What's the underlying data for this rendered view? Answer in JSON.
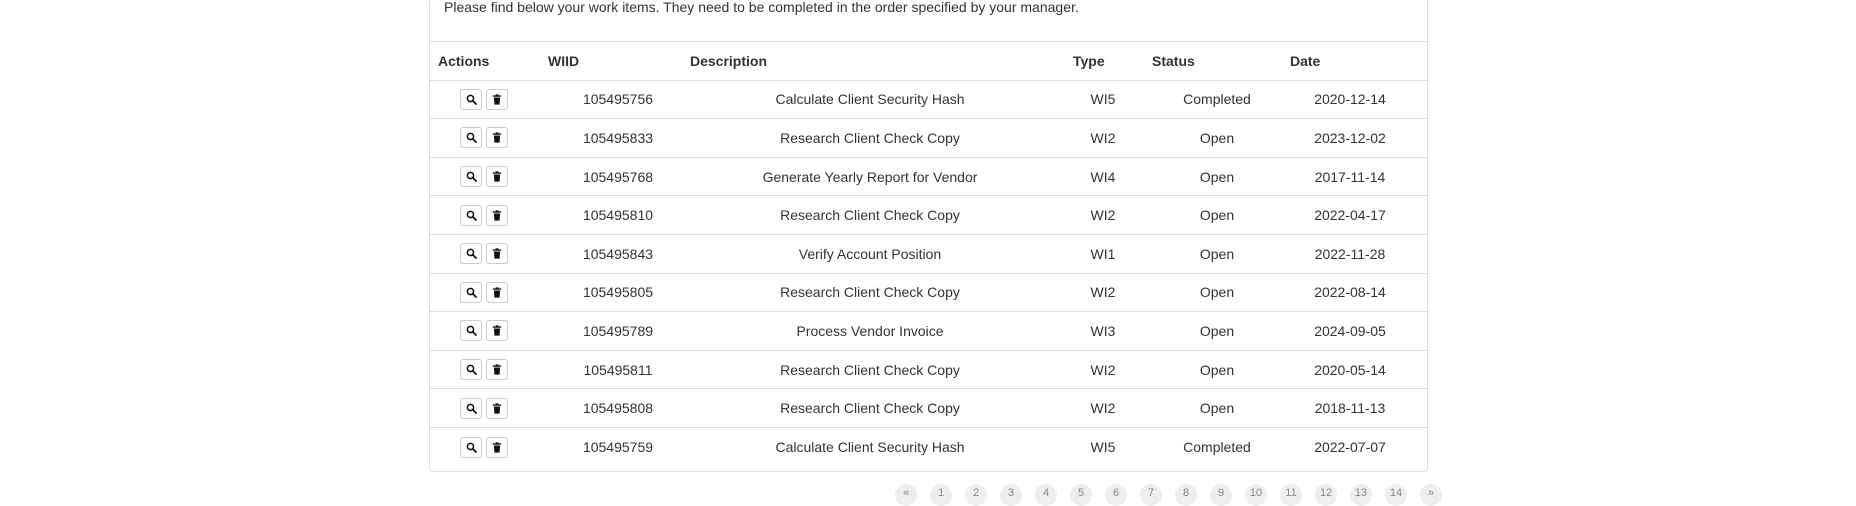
{
  "intro_text": "Please find below your work items. They need to be completed in the order specified by your manager.",
  "table": {
    "headers": {
      "actions": "Actions",
      "wiid": "WIID",
      "description": "Description",
      "type": "Type",
      "status": "Status",
      "date": "Date"
    },
    "rows": [
      {
        "wiid": "105495756",
        "description": "Calculate Client Security Hash",
        "type": "WI5",
        "status": "Completed",
        "date": "2020-12-14"
      },
      {
        "wiid": "105495833",
        "description": "Research Client Check Copy",
        "type": "WI2",
        "status": "Open",
        "date": "2023-12-02"
      },
      {
        "wiid": "105495768",
        "description": "Generate Yearly Report for Vendor",
        "type": "WI4",
        "status": "Open",
        "date": "2017-11-14"
      },
      {
        "wiid": "105495810",
        "description": "Research Client Check Copy",
        "type": "WI2",
        "status": "Open",
        "date": "2022-04-17"
      },
      {
        "wiid": "105495843",
        "description": "Verify Account Position",
        "type": "WI1",
        "status": "Open",
        "date": "2022-11-28"
      },
      {
        "wiid": "105495805",
        "description": "Research Client Check Copy",
        "type": "WI2",
        "status": "Open",
        "date": "2022-08-14"
      },
      {
        "wiid": "105495789",
        "description": "Process Vendor Invoice",
        "type": "WI3",
        "status": "Open",
        "date": "2024-09-05"
      },
      {
        "wiid": "105495811",
        "description": "Research Client Check Copy",
        "type": "WI2",
        "status": "Open",
        "date": "2020-05-14"
      },
      {
        "wiid": "105495808",
        "description": "Research Client Check Copy",
        "type": "WI2",
        "status": "Open",
        "date": "2018-11-13"
      },
      {
        "wiid": "105495759",
        "description": "Calculate Client Security Hash",
        "type": "WI5",
        "status": "Completed",
        "date": "2022-07-07"
      }
    ],
    "row_actions": [
      "search-icon",
      "trash-icon"
    ]
  },
  "pagination": {
    "items": [
      "«",
      "1",
      "2",
      "3",
      "4",
      "5",
      "6",
      "7",
      "8",
      "9",
      "10",
      "11",
      "12",
      "13",
      "14",
      "»"
    ]
  }
}
